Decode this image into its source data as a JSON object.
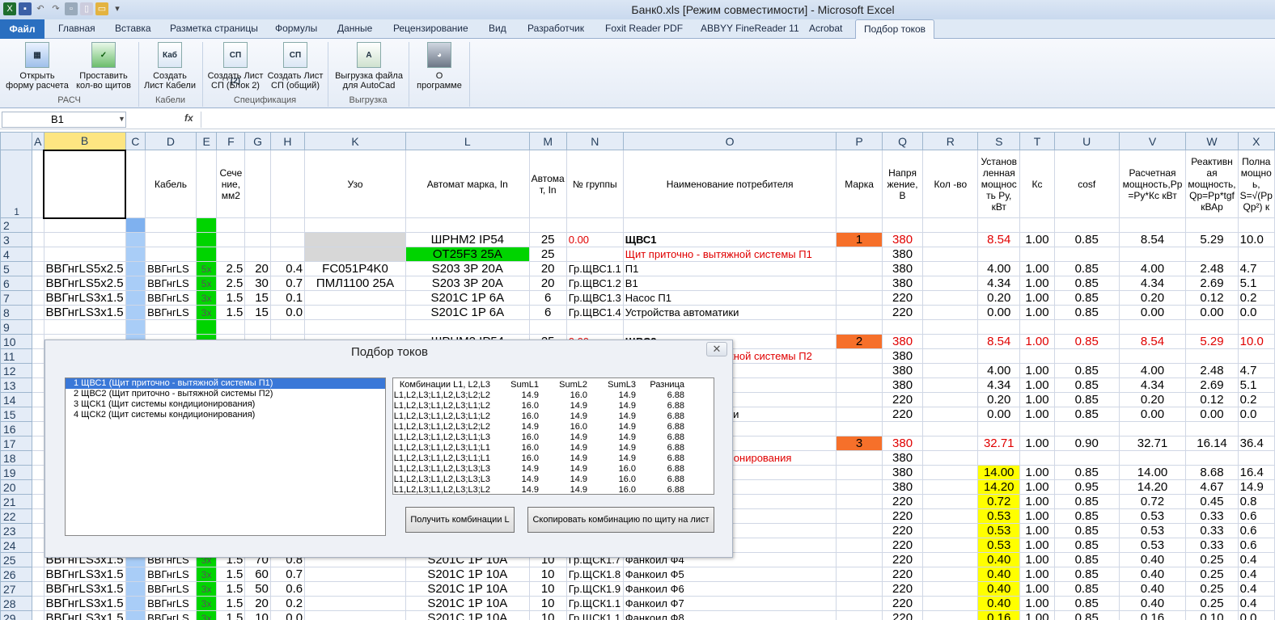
{
  "window": {
    "title": "Банк0.xls  [Режим совместимости]  -  Microsoft Excel"
  },
  "tabs": {
    "file": "Файл",
    "items": [
      "Главная",
      "Вставка",
      "Разметка страницы",
      "Формулы",
      "Данные",
      "Рецензирование",
      "Вид",
      "Разработчик",
      "Foxit Reader PDF",
      "ABBYY FineReader 11",
      "Acrobat"
    ],
    "active": "Подбор токов"
  },
  "ribbon": {
    "b1": {
      "l1": "Открыть",
      "l2": "форму расчета",
      "icon": "calc-form-icon"
    },
    "b2": {
      "l1": "Проставить",
      "l2": "кол-во щитов",
      "icon": "excel-check-icon"
    },
    "b3": {
      "l1": "Создать",
      "l2": "Лист Кабели",
      "icon": "Каб"
    },
    "b4": {
      "l1": "Создать Лист",
      "l2": "СП (Блок 2)",
      "icon": "СП (2)"
    },
    "b5": {
      "l1": "Создать Лист",
      "l2": "СП (общий)",
      "icon": "СП"
    },
    "b6": {
      "l1": "Выгрузка файла",
      "l2": "для AutoCad",
      "icon": "autocad-export-icon"
    },
    "b7": {
      "l1": "О",
      "l2": "программе",
      "icon": "husky-icon"
    },
    "g1": "РАСЧ",
    "g2": "Кабели",
    "g3": "Спецификация",
    "g4": "Выгрузка"
  },
  "formula_bar": {
    "name_box": "B1",
    "fx": "fx",
    "value": ""
  },
  "columns": [
    "A",
    "B",
    "C",
    "D",
    "E",
    "F",
    "G",
    "H",
    "K",
    "L",
    "M",
    "N",
    "O",
    "P",
    "Q",
    "R",
    "S",
    "T",
    "U",
    "V",
    "W",
    "X"
  ],
  "headers": {
    "D": "Кабель",
    "F": "Сече ние, мм2",
    "K": "Узо",
    "L": "Автомат марка, In",
    "M": "Автома т, In",
    "N": "№ группы",
    "O": "Наименование потребителя",
    "P": "Марка",
    "Q": "Напря жение, В",
    "R": "Кол -во",
    "S": "Установ ленная мощнос ть Ру, кВт",
    "T": "Кс",
    "U": "cosf",
    "V": "Расчетная мощность,Рр =Ру*Кс кВт",
    "W": "Реактивн ая мощность, Qp=Pp*tgf кВАр",
    "X": "Полна мощно ь, S=√(Рр Qp²) к"
  },
  "rows": [
    {
      "n": "2"
    },
    {
      "n": "3",
      "K": "",
      "L": "ШРНМ2 IP54",
      "M": "25",
      "N": "0.00",
      "O": "ЩВС1",
      "P": "1",
      "Q": "380",
      "S": "8.54",
      "T": "1.00",
      "U": "0.85",
      "V": "8.54",
      "W": "5.29",
      "X": "10.0"
    },
    {
      "n": "4",
      "L": "OT25F3 25A",
      "M": "25",
      "O": "Щит приточно - вытяжной системы П1",
      "Q": "380"
    },
    {
      "n": "5",
      "B": "ВВГнгLS5х2.5",
      "D": "ВВГнгLS",
      "E": "5х",
      "F": "2.5",
      "G": "20",
      "H": "0.4",
      "K": "FC051P4K0",
      "L": "S203 3P 20A",
      "M": "20",
      "N": "Гр.ЩВС1.1",
      "O": "П1",
      "Q": "380",
      "S": "4.00",
      "T": "1.00",
      "U": "0.85",
      "V": "4.00",
      "W": "2.48",
      "X": "4.7"
    },
    {
      "n": "6",
      "B": "ВВГнгLS5х2.5",
      "D": "ВВГнгLS",
      "E": "5х",
      "F": "2.5",
      "G": "30",
      "H": "0.7",
      "K": "ПМЛ1100 25А",
      "L": "S203 3P 20A",
      "M": "20",
      "N": "Гр.ЩВС1.2",
      "O": "В1",
      "Q": "380",
      "S": "4.34",
      "T": "1.00",
      "U": "0.85",
      "V": "4.34",
      "W": "2.69",
      "X": "5.1"
    },
    {
      "n": "7",
      "B": "ВВГнгLS3х1.5",
      "D": "ВВГнгLS",
      "E": "3х",
      "F": "1.5",
      "G": "15",
      "H": "0.1",
      "L": "S201C 1P 6A",
      "M": "6",
      "N": "Гр.ЩВС1.3",
      "O": "Насос П1",
      "Q": "220",
      "S": "0.20",
      "T": "1.00",
      "U": "0.85",
      "V": "0.20",
      "W": "0.12",
      "X": "0.2"
    },
    {
      "n": "8",
      "B": "ВВГнгLS3х1.5",
      "D": "ВВГнгLS",
      "E": "3х",
      "F": "1.5",
      "G": "15",
      "H": "0.0",
      "L": "S201C 1P 6A",
      "M": "6",
      "N": "Гр.ЩВС1.4",
      "O": "Устройства автоматики",
      "Q": "220",
      "S": "0.00",
      "T": "1.00",
      "U": "0.85",
      "V": "0.00",
      "W": "0.00",
      "X": "0.0"
    },
    {
      "n": "9"
    },
    {
      "n": "10",
      "L": "ШРНМ2 IP54",
      "M": "25",
      "N": "0.00",
      "O": "ЩВС2",
      "P": "2",
      "Q": "380",
      "S": "8.54",
      "T": "1.00",
      "U": "0.85",
      "V": "8.54",
      "W": "5.29",
      "X": "10.0"
    },
    {
      "n": "11",
      "O": "Щит приточно - вытяжной системы П2",
      "Q": "380"
    },
    {
      "n": "12",
      "Q": "380",
      "S": "4.00",
      "T": "1.00",
      "U": "0.85",
      "V": "4.00",
      "W": "2.48",
      "X": "4.7"
    },
    {
      "n": "13",
      "Q": "380",
      "S": "4.34",
      "T": "1.00",
      "U": "0.85",
      "V": "4.34",
      "W": "2.69",
      "X": "5.1"
    },
    {
      "n": "14",
      "Q": "220",
      "S": "0.20",
      "T": "1.00",
      "U": "0.85",
      "V": "0.20",
      "W": "0.12",
      "X": "0.2"
    },
    {
      "n": "15",
      "O": "Устройства автоматики",
      "Q": "220",
      "S": "0.00",
      "T": "1.00",
      "U": "0.85",
      "V": "0.00",
      "W": "0.00",
      "X": "0.0"
    },
    {
      "n": "16"
    },
    {
      "n": "17",
      "P": "3",
      "Q": "380",
      "S": "32.71",
      "T": "1.00",
      "U": "0.90",
      "V": "32.71",
      "W": "16.14",
      "X": "36.4"
    },
    {
      "n": "18",
      "O": "Щит системы кондиционирования",
      "Q": "380"
    },
    {
      "n": "19",
      "Q": "380",
      "S": "14.00",
      "T": "1.00",
      "U": "0.85",
      "V": "14.00",
      "W": "8.68",
      "X": "16.4"
    },
    {
      "n": "20",
      "Q": "380",
      "S": "14.20",
      "T": "1.00",
      "U": "0.95",
      "V": "14.20",
      "W": "4.67",
      "X": "14.9"
    },
    {
      "n": "21",
      "Q": "220",
      "S": "0.72",
      "T": "1.00",
      "U": "0.85",
      "V": "0.72",
      "W": "0.45",
      "X": "0.8"
    },
    {
      "n": "22",
      "Q": "220",
      "S": "0.53",
      "T": "1.00",
      "U": "0.85",
      "V": "0.53",
      "W": "0.33",
      "X": "0.6"
    },
    {
      "n": "23",
      "Q": "220",
      "S": "0.53",
      "T": "1.00",
      "U": "0.85",
      "V": "0.53",
      "W": "0.33",
      "X": "0.6"
    },
    {
      "n": "24",
      "Q": "220",
      "S": "0.53",
      "T": "1.00",
      "U": "0.85",
      "V": "0.53",
      "W": "0.33",
      "X": "0.6"
    },
    {
      "n": "25",
      "B": "ВВГнгLS3х1.5",
      "D": "ВВГнгLS",
      "E": "3х",
      "F": "1.5",
      "G": "70",
      "H": "0.8",
      "L": "S201C 1P 10A",
      "M": "10",
      "N": "Гр.ЩСК1.7",
      "O": "Фанкоил Ф4",
      "Q": "220",
      "S": "0.40",
      "T": "1.00",
      "U": "0.85",
      "V": "0.40",
      "W": "0.25",
      "X": "0.4"
    },
    {
      "n": "26",
      "B": "ВВГнгLS3х1.5",
      "D": "ВВГнгLS",
      "E": "3х",
      "F": "1.5",
      "G": "60",
      "H": "0.7",
      "L": "S201C 1P 10A",
      "M": "10",
      "N": "Гр.ЩСК1.8",
      "O": "Фанкоил Ф5",
      "Q": "220",
      "S": "0.40",
      "T": "1.00",
      "U": "0.85",
      "V": "0.40",
      "W": "0.25",
      "X": "0.4"
    },
    {
      "n": "27",
      "B": "ВВГнгLS3х1.5",
      "D": "ВВГнгLS",
      "E": "3х",
      "F": "1.5",
      "G": "50",
      "H": "0.6",
      "L": "S201C 1P 10A",
      "M": "10",
      "N": "Гр.ЩСК1.9",
      "O": "Фанкоил Ф6",
      "Q": "220",
      "S": "0.40",
      "T": "1.00",
      "U": "0.85",
      "V": "0.40",
      "W": "0.25",
      "X": "0.4"
    },
    {
      "n": "28",
      "B": "ВВГнгLS3х1.5",
      "D": "ВВГнгLS",
      "E": "3х",
      "F": "1.5",
      "G": "20",
      "H": "0.2",
      "L": "S201C 1P 10A",
      "M": "10",
      "N": "Гр.ЩСК1.1",
      "O": "Фанкоил Ф7",
      "Q": "220",
      "S": "0.40",
      "T": "1.00",
      "U": "0.85",
      "V": "0.40",
      "W": "0.25",
      "X": "0.4"
    },
    {
      "n": "29",
      "B": "ВВГнгLS3х1.5",
      "D": "ВВГнгLS",
      "E": "3х",
      "F": "1.5",
      "G": "10",
      "H": "0.0",
      "L": "S201C 1P 10A",
      "M": "10",
      "N": "Гр.ЩСК1.1",
      "O": "Фанкоил Ф8",
      "Q": "220",
      "S": "0.16",
      "T": "1.00",
      "U": "0.85",
      "V": "0.16",
      "W": "0.10",
      "X": "0.0"
    }
  ],
  "dialog": {
    "title": "Подбор токов",
    "close": "✕",
    "shields": [
      "1 ЩВС1 (Щит приточно - вытяжной системы П1)",
      "2 ЩВС2 (Щит приточно - вытяжной системы П2)",
      "3 ЩСК1 (Щит системы кондиционирования)",
      "4 ЩСК2 (Щит системы кондиционирования)"
    ],
    "combo_header": [
      "Комбинации L1, L2,L3",
      "SumL1",
      "SumL2",
      "SumL3",
      "Разница"
    ],
    "combos": [
      [
        "L1,L2,L3;L1,L2,L3;L2;L2",
        "14.9",
        "16.0",
        "14.9",
        "6.88"
      ],
      [
        "L1,L2,L3;L1,L2,L3;L1;L2",
        "16.0",
        "14.9",
        "14.9",
        "6.88"
      ],
      [
        "L1,L2,L3;L1,L2,L3;L1;L2",
        "16.0",
        "14.9",
        "14.9",
        "6.88"
      ],
      [
        "L1,L2,L3;L1,L2,L3;L2;L2",
        "14.9",
        "16.0",
        "14.9",
        "6.88"
      ],
      [
        "L1,L2,L3;L1,L2,L3;L1;L3",
        "16.0",
        "14.9",
        "14.9",
        "6.88"
      ],
      [
        "L1,L2,L3;L1,L2,L3;L1;L1",
        "16.0",
        "14.9",
        "14.9",
        "6.88"
      ],
      [
        "L1,L2,L3;L1,L2,L3;L1;L1",
        "16.0",
        "14.9",
        "14.9",
        "6.88"
      ],
      [
        "L1,L2,L3;L1,L2,L3;L3;L3",
        "14.9",
        "14.9",
        "16.0",
        "6.88"
      ],
      [
        "L1,L2,L3;L1,L2,L3;L3;L3",
        "14.9",
        "14.9",
        "16.0",
        "6.88"
      ],
      [
        "L1,L2,L3;L1,L2,L3;L3;L2",
        "14.9",
        "14.9",
        "16.0",
        "6.88"
      ]
    ],
    "btn_get": "Получить комбинации L",
    "btn_copy": "Скопировать комбинацию по щиту на лист"
  },
  "colors": {
    "green": "#00d400",
    "blue": "#a9cdf7",
    "orange": "#f6702a",
    "yellow": "#ffff00",
    "red": "#e00000"
  }
}
